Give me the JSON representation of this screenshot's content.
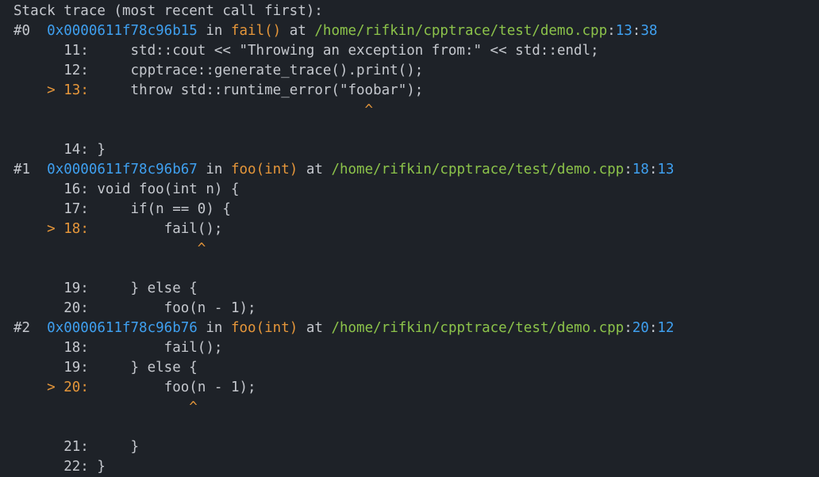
{
  "header": "Stack trace (most recent call first):",
  "frames": [
    {
      "index": "#0",
      "address": "0x0000611f78c96b15",
      "in_word": "in",
      "function": "fail()",
      "at_word": "at",
      "path": "/home/rifkin/cpptrace/test/demo.cpp",
      "line": "13",
      "column": "38",
      "snippet": [
        {
          "ln": "11:",
          "code": "    std::cout << \"Throwing an exception from:\" << std::endl;",
          "highlight": false
        },
        {
          "ln": "12:",
          "code": "    cpptrace::generate_trace().print();",
          "highlight": false
        },
        {
          "ln": "13:",
          "code": "    throw std::runtime_error(\"foobar\");",
          "highlight": true,
          "caret": "                                ^"
        },
        {
          "ln": "14:",
          "code": "}",
          "highlight": false
        }
      ]
    },
    {
      "index": "#1",
      "address": "0x0000611f78c96b67",
      "in_word": "in",
      "function": "foo(int)",
      "at_word": "at",
      "path": "/home/rifkin/cpptrace/test/demo.cpp",
      "line": "18",
      "column": "13",
      "snippet": [
        {
          "ln": "16:",
          "code": "void foo(int n) {",
          "highlight": false
        },
        {
          "ln": "17:",
          "code": "    if(n == 0) {",
          "highlight": false
        },
        {
          "ln": "18:",
          "code": "        fail();",
          "highlight": true,
          "caret": "            ^"
        },
        {
          "ln": "19:",
          "code": "    } else {",
          "highlight": false
        },
        {
          "ln": "20:",
          "code": "        foo(n - 1);",
          "highlight": false
        }
      ]
    },
    {
      "index": "#2",
      "address": "0x0000611f78c96b76",
      "in_word": "in",
      "function": "foo(int)",
      "at_word": "at",
      "path": "/home/rifkin/cpptrace/test/demo.cpp",
      "line": "20",
      "column": "12",
      "snippet": [
        {
          "ln": "18:",
          "code": "        fail();",
          "highlight": false
        },
        {
          "ln": "19:",
          "code": "    } else {",
          "highlight": false
        },
        {
          "ln": "20:",
          "code": "        foo(n - 1);",
          "highlight": true,
          "caret": "           ^"
        },
        {
          "ln": "21:",
          "code": "    }",
          "highlight": false
        },
        {
          "ln": "22:",
          "code": "}",
          "highlight": false
        }
      ]
    }
  ],
  "highlight_marker": ">",
  "colors": {
    "background": "#1e2228",
    "text": "#c5c8ce",
    "address": "#3fa0f0",
    "function": "#e5963a",
    "path": "#8cc34a",
    "marker": "#e5963a"
  }
}
